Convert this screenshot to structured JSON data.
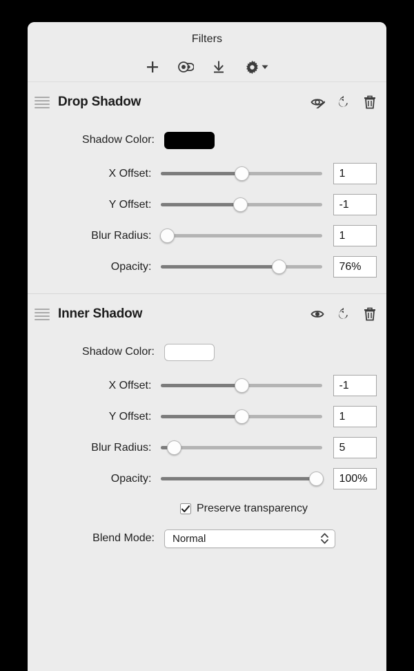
{
  "window": {
    "title": "Filters"
  },
  "toolbar": {
    "items": [
      {
        "name": "add-filter-button",
        "icon": "plus-icon"
      },
      {
        "name": "clone-filter-button",
        "icon": "clone-icon"
      },
      {
        "name": "import-filter-button",
        "icon": "download-icon"
      },
      {
        "name": "filter-options-button",
        "icon": "gear-icon"
      }
    ]
  },
  "sections": [
    {
      "title": "Drop Shadow",
      "visible": false,
      "visibility_icon": "eye-slash-icon",
      "reset_icon": "reset-icon",
      "delete_icon": "trash-icon",
      "color_label": "Shadow Color:",
      "color_value": "#000000",
      "controls": [
        {
          "label": "X Offset:",
          "value": "1",
          "percent": 50
        },
        {
          "label": "Y Offset:",
          "value": "-1",
          "percent": 49
        },
        {
          "label": "Blur Radius:",
          "value": "1",
          "percent": 4
        },
        {
          "label": "Opacity:",
          "value": "76%",
          "percent": 73
        }
      ]
    },
    {
      "title": "Inner Shadow",
      "visible": true,
      "visibility_icon": "eye-icon",
      "reset_icon": "reset-icon",
      "delete_icon": "trash-icon",
      "color_label": "Shadow Color:",
      "color_value": "#ffffff",
      "controls": [
        {
          "label": "X Offset:",
          "value": "-1",
          "percent": 50
        },
        {
          "label": "Y Offset:",
          "value": "1",
          "percent": 50
        },
        {
          "label": "Blur Radius:",
          "value": "5",
          "percent": 8
        },
        {
          "label": "Opacity:",
          "value": "100%",
          "percent": 96
        }
      ],
      "preserve_transparency_label": "Preserve transparency",
      "preserve_transparency_checked": true,
      "blend_mode_label": "Blend Mode:",
      "blend_mode_value": "Normal"
    }
  ],
  "colors": {
    "background": "#ececec",
    "track": "#b4b4b4",
    "track_fill": "#7c7c7c",
    "text": "#1f1f1f"
  }
}
